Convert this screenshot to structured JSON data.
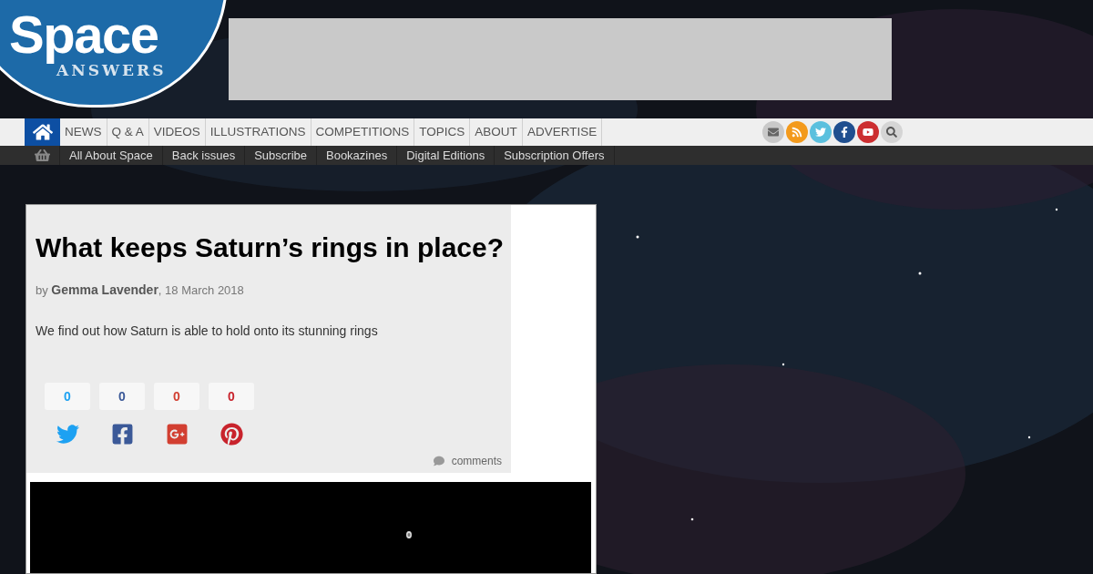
{
  "logo": {
    "title": "Space",
    "subtitle": "ANSWERS"
  },
  "main_nav": [
    {
      "label": "NEWS"
    },
    {
      "label": "Q & A"
    },
    {
      "label": "VIDEOS"
    },
    {
      "label": "ILLUSTRATIONS"
    },
    {
      "label": "COMPETITIONS"
    },
    {
      "label": "TOPICS"
    },
    {
      "label": "ABOUT"
    },
    {
      "label": "ADVERTISE"
    }
  ],
  "social_links": [
    {
      "kind": "email"
    },
    {
      "kind": "rss"
    },
    {
      "kind": "twitter"
    },
    {
      "kind": "facebook"
    },
    {
      "kind": "youtube"
    },
    {
      "kind": "search"
    }
  ],
  "sub_nav": [
    {
      "label": "All About Space"
    },
    {
      "label": "Back issues"
    },
    {
      "label": "Subscribe"
    },
    {
      "label": "Bookazines"
    },
    {
      "label": "Digital Editions"
    },
    {
      "label": "Subscription Offers"
    }
  ],
  "article": {
    "title": "What keeps Saturn’s rings in place?",
    "by": "by",
    "author": "Gemma Lavender",
    "date": ", 18 March 2018",
    "summary": "We find out how Saturn is able to hold onto its stunning rings",
    "shares": [
      {
        "kind": "twitter",
        "count": "0"
      },
      {
        "kind": "facebook",
        "count": "0"
      },
      {
        "kind": "googleplus",
        "count": "0"
      },
      {
        "kind": "pinterest",
        "count": "0"
      }
    ],
    "comments": "comments"
  }
}
